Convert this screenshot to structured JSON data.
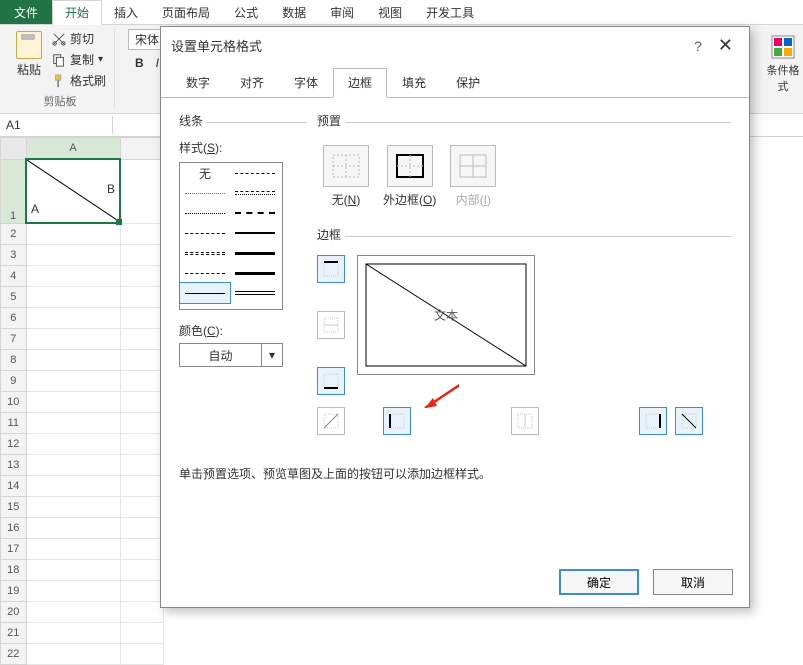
{
  "ribbon": {
    "file": "文件",
    "tabs": [
      "开始",
      "插入",
      "页面布局",
      "公式",
      "数据",
      "审阅",
      "视图",
      "开发工具"
    ],
    "active_tab": "开始",
    "clipboard": {
      "paste": "粘贴",
      "cut": "剪切",
      "copy": "复制",
      "format_painter": "格式刷",
      "group_label": "剪贴板"
    },
    "font_label": "宋体",
    "bold": "B",
    "italic": "I",
    "cond_format": "条件格式"
  },
  "namebox": "A1",
  "sheet": {
    "col_label": "A",
    "cellA_txtA": "A",
    "cellA_txtB": "B",
    "row_count": 22
  },
  "dialog": {
    "title": "设置单元格格式",
    "help": "?",
    "close": "✕",
    "tabs": [
      "数字",
      "对齐",
      "字体",
      "边框",
      "填充",
      "保护"
    ],
    "active_tab": "边框",
    "line_section": "线条",
    "style_label": "样式(S):",
    "style_none": "无",
    "color_label": "颜色(C):",
    "color_value": "自动",
    "preset_section": "预置",
    "presets": {
      "none": "无(N)",
      "outline": "外边框(O)",
      "inside": "内部(I)"
    },
    "border_section": "边框",
    "preview_label": "文本",
    "hint": "单击预置选项、预览草图及上面的按钮可以添加边框样式。",
    "ok": "确定",
    "cancel": "取消"
  }
}
